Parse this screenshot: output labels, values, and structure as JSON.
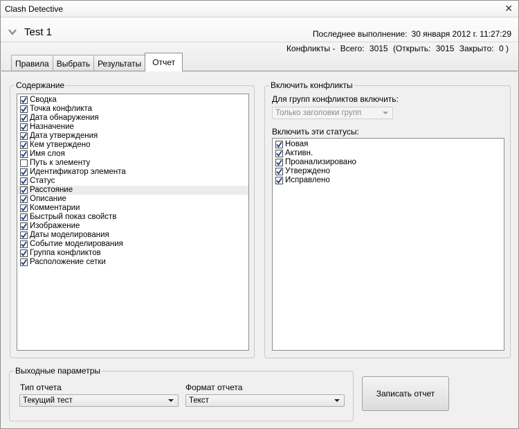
{
  "window": {
    "title": "Clash Detective",
    "close_glyph": "✕"
  },
  "header": {
    "test_name": "Test 1",
    "last_run_label": "Последнее выполнение:",
    "last_run_value": "30 января 2012 г. 11:27:29",
    "counts": {
      "label": "Конфликты -",
      "total_label": "Всего:",
      "total": "3015",
      "open_label": "(Открыть:",
      "open": "3015",
      "closed_label": "Закрыто:",
      "closed": "0 )"
    }
  },
  "tabs": [
    {
      "label": "Правила",
      "active": false
    },
    {
      "label": "Выбрать",
      "active": false
    },
    {
      "label": "Результаты",
      "active": false
    },
    {
      "label": "Отчет",
      "active": true
    }
  ],
  "contents": {
    "legend": "Содержание",
    "items": [
      {
        "label": "Сводка",
        "checked": true
      },
      {
        "label": "Точка конфликта",
        "checked": true
      },
      {
        "label": "Дата обнаружения",
        "checked": true
      },
      {
        "label": "Назначение",
        "checked": true
      },
      {
        "label": "Дата утверждения",
        "checked": true
      },
      {
        "label": "Кем утверждено",
        "checked": true
      },
      {
        "label": "Имя слоя",
        "checked": true
      },
      {
        "label": "Путь к элементу",
        "checked": false
      },
      {
        "label": "Идентификатор элемента",
        "checked": true
      },
      {
        "label": "Статус",
        "checked": true
      },
      {
        "label": "Расстояние",
        "checked": true,
        "highlighted": true
      },
      {
        "label": "Описание",
        "checked": true
      },
      {
        "label": "Комментарии",
        "checked": true
      },
      {
        "label": "Быстрый показ свойств",
        "checked": true
      },
      {
        "label": "Изображение",
        "checked": true
      },
      {
        "label": "Даты моделирования",
        "checked": true
      },
      {
        "label": "Событие моделирования",
        "checked": true
      },
      {
        "label": "Группа конфликтов",
        "checked": true
      },
      {
        "label": "Расположение сетки",
        "checked": true
      }
    ]
  },
  "include_clashes": {
    "legend": "Включить конфликты",
    "groups_label": "Для групп конфликтов включить:",
    "groups_value": "Только заголовки групп",
    "statuses_label": "Включить эти статусы:",
    "statuses": [
      {
        "label": "Новая",
        "checked": true
      },
      {
        "label": "Активн.",
        "checked": true
      },
      {
        "label": "Проанализировано",
        "checked": true
      },
      {
        "label": "Утверждено",
        "checked": true
      },
      {
        "label": "Исправлено",
        "checked": true
      }
    ]
  },
  "output": {
    "legend": "Выходные параметры",
    "report_type_label": "Тип отчета",
    "report_type_value": "Текущий тест",
    "report_format_label": "Формат отчета",
    "report_format_value": "Текст",
    "write_button": "Записать отчет"
  }
}
